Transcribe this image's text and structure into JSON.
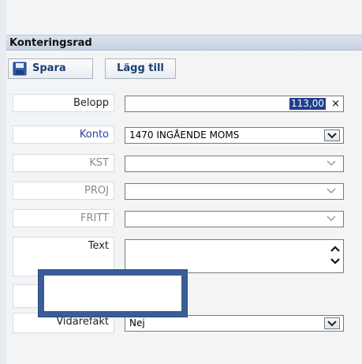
{
  "panel": {
    "title": "Konteringsrad"
  },
  "toolbar": {
    "save_label": "Spara",
    "add_label": "Lägg till"
  },
  "form": {
    "belopp": {
      "label": "Belopp",
      "value": "113,00",
      "clear": "×"
    },
    "konto": {
      "label": "Konto",
      "value": "1470 INGÅENDE MOMS"
    },
    "kst": {
      "label": "KST",
      "value": ""
    },
    "proj": {
      "label": "PROJ",
      "value": ""
    },
    "fritt": {
      "label": "FRITT",
      "value": ""
    },
    "text": {
      "label": "Text",
      "value": ""
    },
    "vidarefakt": {
      "label": "Vidarefakt",
      "value": "Nej"
    }
  },
  "icons": {
    "save": "floppy-disk-icon",
    "dropdown": "chevron-down-icon",
    "spin_up": "chevron-up-icon",
    "spin_down": "chevron-down-icon"
  },
  "colors": {
    "accent": "#1f3f8a",
    "overlay_border": "#3b5c96",
    "label_blue": "#2a3f9f"
  }
}
